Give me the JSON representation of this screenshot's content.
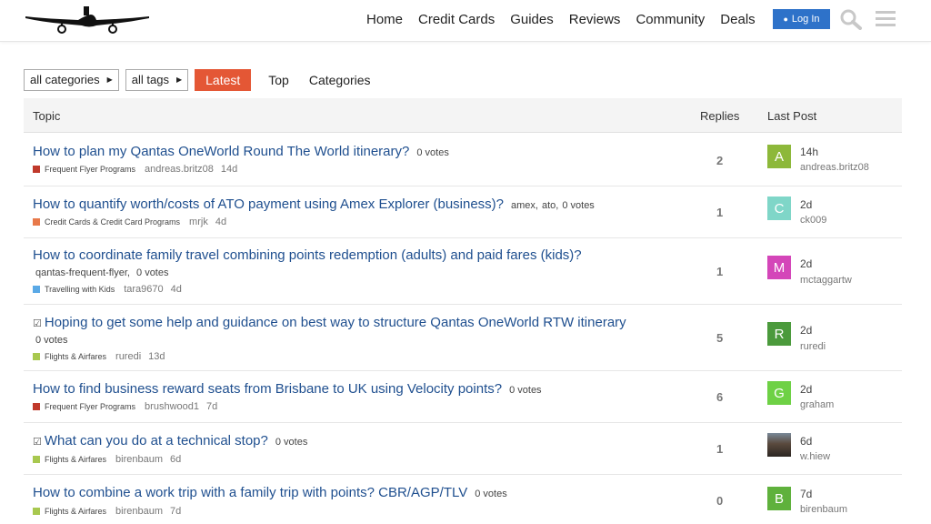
{
  "header": {
    "nav": [
      "Home",
      "Credit Cards",
      "Guides",
      "Reviews",
      "Community",
      "Deals"
    ],
    "login_label": "Log In"
  },
  "filters": {
    "categories": "all categories",
    "tags": "all tags",
    "latest": "Latest",
    "top": "Top",
    "categories_tab": "Categories"
  },
  "table": {
    "col_topic": "Topic",
    "col_replies": "Replies",
    "col_last": "Last Post"
  },
  "topics": [
    {
      "title": "How to plan my Qantas OneWorld Round The World itinerary?",
      "tags": [],
      "votes": "0 votes",
      "category": "Frequent Flyer Programs",
      "cat_color": "#c0392b",
      "author": "andreas.britz08",
      "age": "14d",
      "replies": "2",
      "avatar_letter": "A",
      "avatar_color": "#8db83a",
      "last_time": "14h",
      "last_user": "andreas.britz08",
      "pinned": false
    },
    {
      "title": "How to quantify worth/costs of ATO payment using Amex Explorer (business)?",
      "tags": [
        "amex,",
        "ato,"
      ],
      "votes": "0 votes",
      "category": "Credit Cards & Credit Card Programs",
      "cat_color": "#e8794a",
      "author": "mrjk",
      "age": "4d",
      "replies": "1",
      "avatar_letter": "C",
      "avatar_color": "#7fd6c8",
      "last_time": "2d",
      "last_user": "ck009",
      "pinned": false
    },
    {
      "title": "How to coordinate family travel combining points redemption (adults) and paid fares (kids)?",
      "tags": [
        "qantas-frequent-flyer,"
      ],
      "votes": "0 votes",
      "category": "Travelling with Kids",
      "cat_color": "#5aa9e6",
      "author": "tara9670",
      "age": "4d",
      "replies": "1",
      "avatar_letter": "M",
      "avatar_color": "#d446b9",
      "last_time": "2d",
      "last_user": "mctaggartw",
      "pinned": false
    },
    {
      "title": "Hoping to get some help and guidance on best way to structure Qantas OneWorld RTW itinerary",
      "tags": [],
      "votes": "0 votes",
      "category": "Flights & Airfares",
      "cat_color": "#a8c84f",
      "author": "ruredi",
      "age": "13d",
      "replies": "5",
      "avatar_letter": "R",
      "avatar_color": "#4b9a3c",
      "last_time": "2d",
      "last_user": "ruredi",
      "pinned": true
    },
    {
      "title": "How to find business reward seats from Brisbane to UK using Velocity points?",
      "tags": [],
      "votes": "0 votes",
      "category": "Frequent Flyer Programs",
      "cat_color": "#c0392b",
      "author": "brushwood1",
      "age": "7d",
      "replies": "6",
      "avatar_letter": "G",
      "avatar_color": "#6ed145",
      "last_time": "2d",
      "last_user": "graham",
      "pinned": false
    },
    {
      "title": "What can you do at a technical stop?",
      "tags": [],
      "votes": "0 votes",
      "category": "Flights & Airfares",
      "cat_color": "#a8c84f",
      "author": "birenbaum",
      "age": "6d",
      "replies": "1",
      "avatar_letter": "",
      "avatar_color": "#6b5a4a",
      "last_time": "6d",
      "last_user": "w.hiew",
      "pinned": true
    },
    {
      "title": "How to combine a work trip with a family trip with points? CBR/AGP/TLV",
      "tags": [],
      "votes": "0 votes",
      "category": "Flights & Airfares",
      "cat_color": "#a8c84f",
      "author": "birenbaum",
      "age": "7d",
      "replies": "0",
      "avatar_letter": "B",
      "avatar_color": "#5fb13c",
      "last_time": "7d",
      "last_user": "birenbaum",
      "pinned": false
    }
  ]
}
